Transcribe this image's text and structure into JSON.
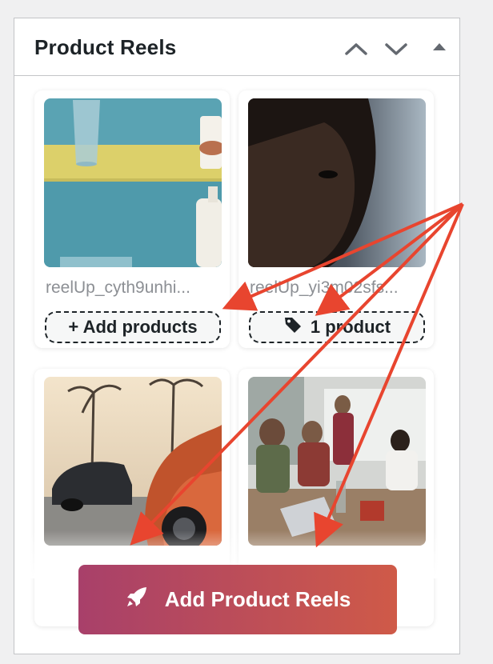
{
  "panel": {
    "title": "Product Reels",
    "controls": [
      "chevron-up-icon",
      "chevron-down-icon",
      "triangle-up-icon"
    ]
  },
  "reels": [
    {
      "name": "reelUp_cyth9unhi...",
      "action_label": "+ Add products",
      "action_icon": ""
    },
    {
      "name": "reelUp_yi3m02sfs...",
      "action_label": "1 product",
      "action_icon": "tag-icon"
    },
    {
      "name": "",
      "action_label": "",
      "action_icon": ""
    },
    {
      "name": "",
      "action_label": "",
      "action_icon": ""
    }
  ],
  "primary_button": {
    "label": "Add Product Reels",
    "icon": "rocket-icon"
  },
  "colors": {
    "button_gradient_start": "#a8406a",
    "button_gradient_end": "#cf5a48",
    "annotation_arrow": "#e8452f"
  }
}
